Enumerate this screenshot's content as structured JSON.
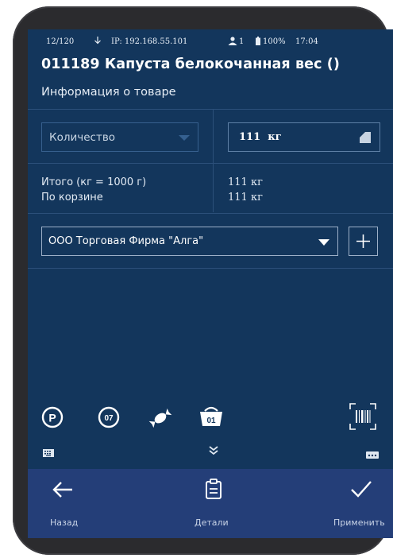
{
  "status": {
    "counter": "12/120",
    "ip": "IP: 192.168.55.101",
    "users": "1",
    "battery": "100%",
    "time": "17:04"
  },
  "product": {
    "title": "011189 Капуста белокочанная вес ()",
    "subtitle": "Информация о товаре"
  },
  "quantity": {
    "mode_label": "Количество",
    "value": "111",
    "unit": "кг"
  },
  "totals": {
    "label_total": "Итого (кг = 1000 г)",
    "label_basket": "По корзине",
    "value_total": "111 кг",
    "value_basket": "111 кг"
  },
  "supplier": {
    "selected": "ООО Торговая Фирма \"Алга\""
  },
  "tools": {
    "p_badge": "P",
    "code_badge": "07",
    "basket_badge": "01"
  },
  "bottom_nav": {
    "back_label": "Назад",
    "details_label": "Детали",
    "apply_label": "Применить"
  }
}
